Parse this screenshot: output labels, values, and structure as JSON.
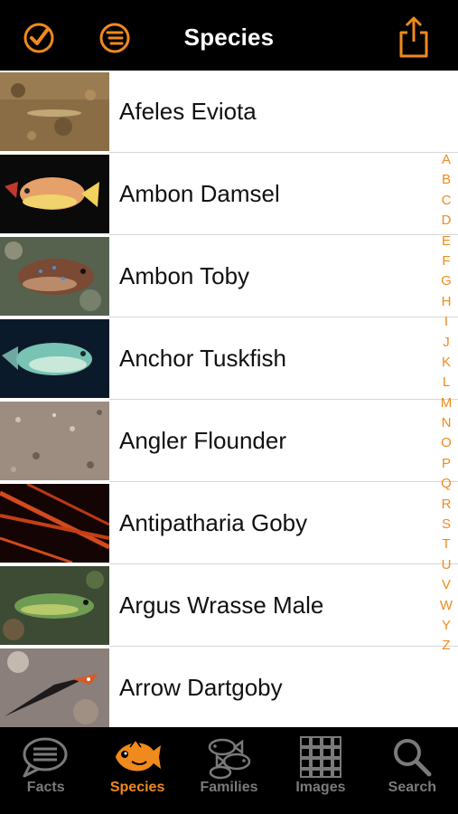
{
  "header": {
    "title": "Species"
  },
  "species": [
    {
      "name": "Afeles Eviota"
    },
    {
      "name": "Ambon Damsel"
    },
    {
      "name": "Ambon Toby"
    },
    {
      "name": "Anchor Tuskfish"
    },
    {
      "name": "Angler Flounder"
    },
    {
      "name": "Antipatharia Goby"
    },
    {
      "name": "Argus Wrasse Male"
    },
    {
      "name": "Arrow Dartgoby"
    }
  ],
  "index": [
    "A",
    "B",
    "C",
    "D",
    "E",
    "F",
    "G",
    "H",
    "I",
    "J",
    "K",
    "L",
    "M",
    "N",
    "O",
    "P",
    "Q",
    "R",
    "S",
    "T",
    "U",
    "V",
    "W",
    "Y",
    "Z"
  ],
  "tabs": [
    {
      "label": "Facts",
      "icon": "speech-bubble-icon"
    },
    {
      "label": "Species",
      "icon": "fish-icon",
      "active": true
    },
    {
      "label": "Families",
      "icon": "fish-group-icon"
    },
    {
      "label": "Images",
      "icon": "grid-icon"
    },
    {
      "label": "Search",
      "icon": "magnifier-icon"
    }
  ],
  "colors": {
    "accent": "#f08a1c",
    "inactive": "#7a7a7a"
  }
}
